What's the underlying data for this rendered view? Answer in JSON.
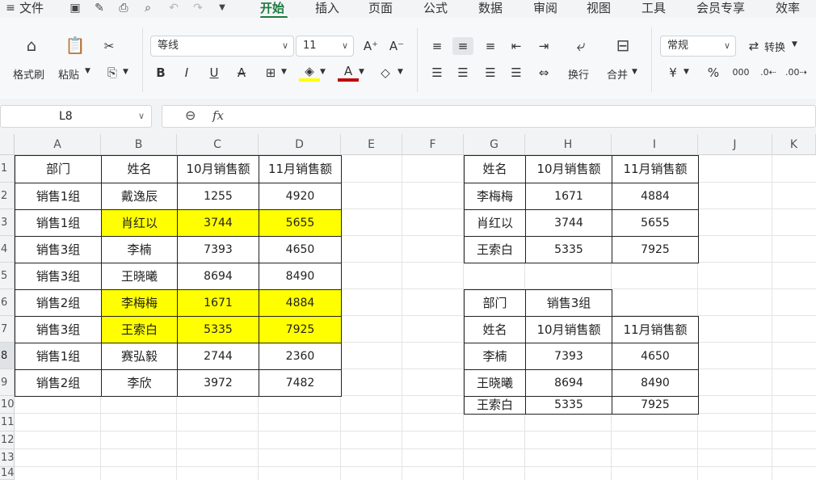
{
  "menu": {
    "file": "文件",
    "tabs": [
      "开始",
      "插入",
      "页面",
      "公式",
      "数据",
      "审阅",
      "视图",
      "工具",
      "会员专享",
      "效率"
    ],
    "active_tab": "开始"
  },
  "ribbon": {
    "format_painter": "格式刷",
    "paste": "粘贴",
    "font_name": "等线",
    "font_size": "11",
    "wrap": "换行",
    "merge": "合并",
    "number_format": "常规",
    "convert": "转换"
  },
  "formula_bar": {
    "name_box": "L8",
    "fx": "fx",
    "value": ""
  },
  "columns": [
    "A",
    "B",
    "C",
    "D",
    "E",
    "F",
    "G",
    "H",
    "I",
    "J",
    "K"
  ],
  "rows": [
    "1",
    "2",
    "3",
    "4",
    "5",
    "6",
    "7",
    "8",
    "9",
    "10",
    "11",
    "12",
    "13",
    "14"
  ],
  "main_table": {
    "headers": [
      "部门",
      "姓名",
      "10月销售额",
      "11月销售额"
    ],
    "rows": [
      [
        "销售1组",
        "戴逸辰",
        "1255",
        "4920"
      ],
      [
        "销售1组",
        "肖红以",
        "3744",
        "5655"
      ],
      [
        "销售3组",
        "李楠",
        "7393",
        "4650"
      ],
      [
        "销售3组",
        "王晓曦",
        "8694",
        "8490"
      ],
      [
        "销售2组",
        "李梅梅",
        "1671",
        "4884"
      ],
      [
        "销售3组",
        "王索白",
        "5335",
        "7925"
      ],
      [
        "销售1组",
        "赛弘毅",
        "2744",
        "2360"
      ],
      [
        "销售2组",
        "李欣",
        "3972",
        "7482"
      ]
    ],
    "highlighted_rows": [
      1,
      4,
      5
    ]
  },
  "lookup_table": {
    "headers": [
      "姓名",
      "10月销售额",
      "11月销售额"
    ],
    "rows": [
      [
        "李梅梅",
        "1671",
        "4884"
      ],
      [
        "肖红以",
        "3744",
        "5655"
      ],
      [
        "王索白",
        "5335",
        "7925"
      ]
    ]
  },
  "dept_filter": {
    "label": "部门",
    "value": "销售3组"
  },
  "filter_table": {
    "headers": [
      "姓名",
      "10月销售额",
      "11月销售额"
    ],
    "rows": [
      [
        "李楠",
        "7393",
        "4650"
      ],
      [
        "王晓曦",
        "8694",
        "8490"
      ],
      [
        "王索白",
        "5335",
        "7925"
      ]
    ]
  },
  "colors": {
    "accent": "#1d7a3e",
    "highlight": "#ffff00"
  }
}
